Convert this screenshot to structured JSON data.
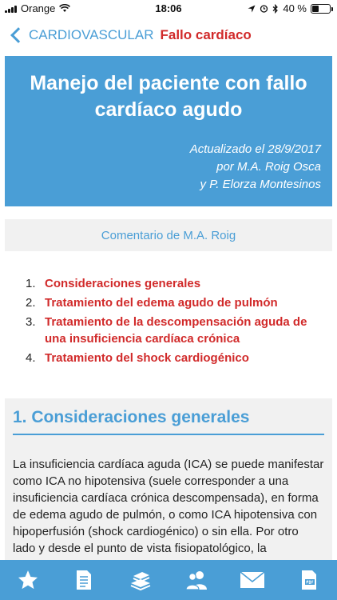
{
  "status_bar": {
    "carrier": "Orange",
    "time": "18:06",
    "battery": "40 %",
    "battery_level": 0.4
  },
  "nav": {
    "back_label": "CARDIOVASCULAR",
    "title": "Fallo cardíaco"
  },
  "header": {
    "title": "Manejo del paciente con fallo cardíaco agudo",
    "updated": "Actualizado el 28/9/2017",
    "author1": "por M.A. Roig Osca",
    "author2": "y P. Elorza Montesinos"
  },
  "comment": {
    "label": "Comentario de M.A. Roig"
  },
  "toc": [
    {
      "num": "1.",
      "label": "Consideraciones generales"
    },
    {
      "num": "2.",
      "label": "Tratamiento del edema agudo de pulmón"
    },
    {
      "num": "3.",
      "label": "Tratamiento de la descompensación aguda de una insuficiencia cardíaca crónica"
    },
    {
      "num": "4.",
      "label": "Tratamiento del shock cardiogénico"
    }
  ],
  "section": {
    "heading": "1. Consideraciones generales",
    "body": "La insuficiencia cardíaca aguda (ICA) se puede manifestar como ICA no hipotensiva (suele corresponder a una insuficiencia cardíaca crónica descompensada), en forma de edema agudo de pulmón, o como ICA hipotensiva con hipoperfusión (shock cardiogénico) o sin ella. Por otro lado y desde el punto de vista fisiopatológico, la insuficiencia"
  },
  "tabs": [
    {
      "icon": "star-icon"
    },
    {
      "icon": "document-icon"
    },
    {
      "icon": "books-icon"
    },
    {
      "icon": "contacts-icon"
    },
    {
      "icon": "mail-icon"
    },
    {
      "icon": "pdf-icon"
    }
  ],
  "colors": {
    "accent": "#4a9ed6",
    "link": "#d12a2a",
    "panel": "#f1f1f1"
  }
}
